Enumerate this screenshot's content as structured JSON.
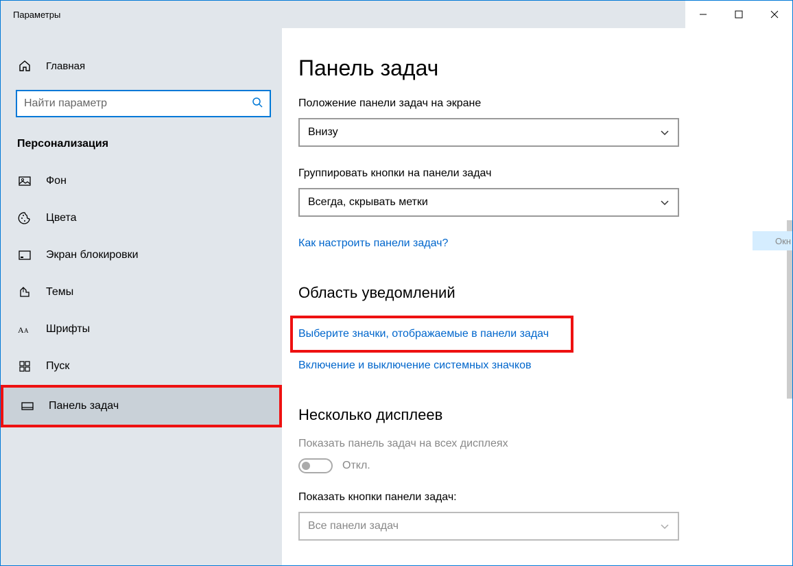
{
  "window": {
    "title": "Параметры"
  },
  "sidebar": {
    "home": "Главная",
    "search_placeholder": "Найти параметр",
    "category": "Персонализация",
    "items": [
      {
        "label": "Фон"
      },
      {
        "label": "Цвета"
      },
      {
        "label": "Экран блокировки"
      },
      {
        "label": "Темы"
      },
      {
        "label": "Шрифты"
      },
      {
        "label": "Пуск"
      },
      {
        "label": "Панель задач"
      }
    ]
  },
  "main": {
    "title": "Панель задач",
    "position_label": "Положение панели задач на экране",
    "position_value": "Внизу",
    "group_label": "Группировать кнопки на панели задач",
    "group_value": "Всегда, скрывать метки",
    "help_link": "Как настроить панели задач?",
    "notif_title": "Область уведомлений",
    "notif_link1": "Выберите значки, отображаемые в панели задач",
    "notif_link2": "Включение и выключение системных значков",
    "displays_title": "Несколько дисплеев",
    "displays_show_label": "Показать панель задач на всех дисплеях",
    "toggle_off": "Откл.",
    "displays_buttons_label": "Показать кнопки панели задач:",
    "displays_buttons_value": "Все панели задач"
  },
  "peek": "Окн"
}
